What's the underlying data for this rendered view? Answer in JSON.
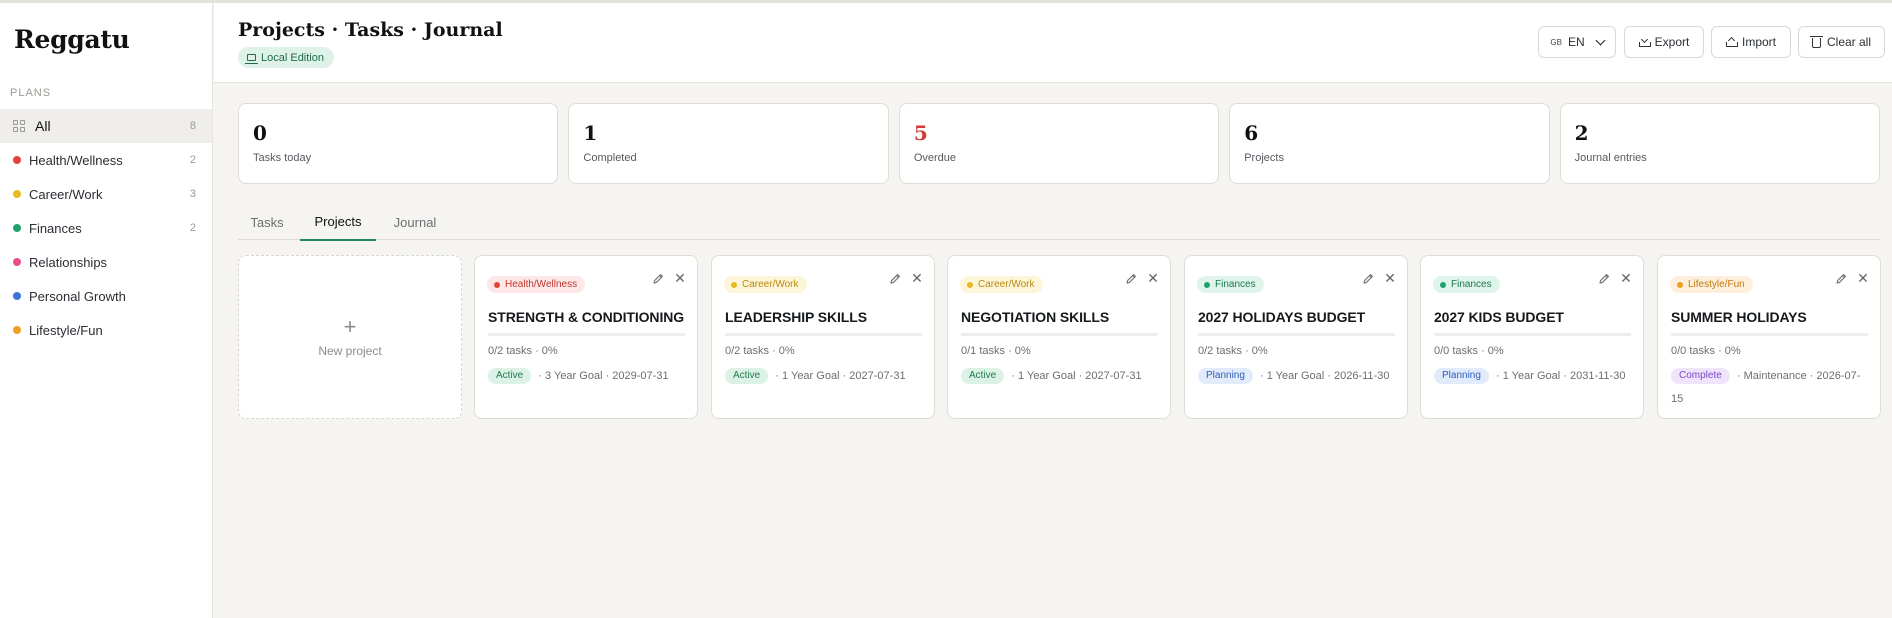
{
  "app": {
    "brand": "Reggatu"
  },
  "sidebar": {
    "section_title": "PLANS",
    "items": [
      {
        "label": "All",
        "count": "8",
        "icon": "grid-icon",
        "active": true
      },
      {
        "label": "Health/Wellness",
        "count": "2",
        "color": "#e0443d"
      },
      {
        "label": "Career/Work",
        "count": "3",
        "color": "#e8b923"
      },
      {
        "label": "Finances",
        "count": "2",
        "color": "#1fa36b"
      },
      {
        "label": "Relationships",
        "count": "",
        "color": "#e84d8a"
      },
      {
        "label": "Personal Growth",
        "count": "",
        "color": "#3b74d9"
      },
      {
        "label": "Lifestyle/Fun",
        "count": "",
        "color": "#f0a020"
      }
    ]
  },
  "header": {
    "title": "Projects · Tasks · Journal",
    "edition": "Local Edition",
    "language": "EN",
    "language_flag": "GB",
    "export_label": "Export",
    "import_label": "Import",
    "clear_label": "Clear all"
  },
  "stats": [
    {
      "value": "0",
      "label": "Tasks today"
    },
    {
      "value": "1",
      "label": "Completed"
    },
    {
      "value": "5",
      "label": "Overdue",
      "alert": true
    },
    {
      "value": "6",
      "label": "Projects"
    },
    {
      "value": "2",
      "label": "Journal entries"
    }
  ],
  "tabs": {
    "tasks": "Tasks",
    "projects": "Projects",
    "journal": "Journal",
    "active": "Projects"
  },
  "new_project": {
    "plus": "+",
    "label": "New project"
  },
  "projects": [
    {
      "category": "Health/Wellness",
      "cat_color": "#e0443d",
      "cat_bg": "#fde8e7",
      "cat_fg": "#c2372f",
      "title": "STRENGTH & CONDITIONING",
      "tasks": "0/2 tasks · 0%",
      "progress": 0,
      "status": "Active",
      "status_bg": "#dcf2e6",
      "status_fg": "#1f7a4d",
      "goal": "· 3 Year Goal",
      "date": "· 2029-07-31"
    },
    {
      "category": "Career/Work",
      "cat_color": "#e8b923",
      "cat_bg": "#fdf5d8",
      "cat_fg": "#b78a0c",
      "title": "LEADERSHIP SKILLS",
      "tasks": "0/2 tasks · 0%",
      "progress": 0,
      "status": "Active",
      "status_bg": "#dcf2e6",
      "status_fg": "#1f7a4d",
      "goal": "· 1 Year Goal",
      "date": "· 2027-07-31"
    },
    {
      "category": "Career/Work",
      "cat_color": "#e8b923",
      "cat_bg": "#fdf5d8",
      "cat_fg": "#b78a0c",
      "title": "NEGOTIATION SKILLS",
      "tasks": "0/1 tasks · 0%",
      "progress": 0,
      "status": "Active",
      "status_bg": "#dcf2e6",
      "status_fg": "#1f7a4d",
      "goal": "· 1 Year Goal",
      "date": "· 2027-07-31"
    },
    {
      "category": "Finances",
      "cat_color": "#1fa36b",
      "cat_bg": "#dff4ea",
      "cat_fg": "#1a7a50",
      "title": "2027 HOLIDAYS BUDGET",
      "tasks": "0/2 tasks · 0%",
      "progress": 0,
      "status": "Planning",
      "status_bg": "#e2ebfb",
      "status_fg": "#2f5db8",
      "goal": "· 1 Year Goal",
      "date": "· 2026-11-30"
    },
    {
      "category": "Finances",
      "cat_color": "#1fa36b",
      "cat_bg": "#dff4ea",
      "cat_fg": "#1a7a50",
      "title": "2027 KIDS BUDGET",
      "tasks": "0/0 tasks · 0%",
      "progress": 0,
      "status": "Planning",
      "status_bg": "#e2ebfb",
      "status_fg": "#2f5db8",
      "goal": "· 1 Year Goal",
      "date": "· 2031-11-30"
    },
    {
      "category": "Lifestyle/Fun",
      "cat_color": "#f0a020",
      "cat_bg": "#fdefdc",
      "cat_fg": "#c47a0d",
      "title": "SUMMER HOLIDAYS",
      "tasks": "0/0 tasks · 0%",
      "progress": 0,
      "status": "Complete",
      "status_bg": "#efe4fb",
      "status_fg": "#7b49c6",
      "goal": "· Maintenance",
      "date": "· 2026-07-15"
    }
  ]
}
